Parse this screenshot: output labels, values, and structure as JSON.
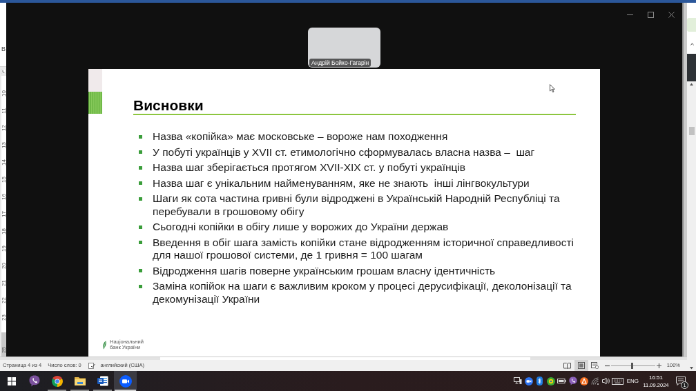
{
  "word_window": {
    "ribbon_text": "В",
    "ruler": {
      "labels": [
        "10",
        "11",
        "12",
        "13",
        "14",
        "15",
        "16",
        "17",
        "18",
        "19",
        "20",
        "21",
        "22",
        "23"
      ],
      "bottom_label": "25"
    },
    "status_bar": {
      "page": "Страница 4 из 4",
      "word_count": "Число слов: 0",
      "language": "английский (США)",
      "views": [
        {
          "kind": "read",
          "selected": false
        },
        {
          "kind": "print",
          "selected": true
        },
        {
          "kind": "web",
          "selected": false
        }
      ],
      "zoom": {
        "level": 0.48,
        "reading": "100%"
      }
    }
  },
  "zoom_window": {
    "video_tile": {
      "name": "Андрій Бойко-Гагарін"
    },
    "slide": {
      "title": "Висновки",
      "bullets": [
        "Назва «копійка» має московське – вороже нам походження",
        "У побуті українців у XVII ст. етимологічно сформувалась власна назва –  шаг",
        "Назва шаг зберігається протягом XVII-XIX ст. у побуті українців",
        "Назва шаг є унікальним найменуванням, яке не знають  інші лінгвокультури",
        "Шаги як сота частина гривні були відроджені в Українській Народній Республіці та перебували в грошовому обігу",
        "Сьогодні копійки в обігу лише у ворожих до України держав",
        "Введення в обіг шага замість копійки стане відродженням історичної справедливості для нашої грошової системи, де 1 гривня = 100 шагам",
        "Відродження шагів поверне українським грошам власну ідентичність",
        "Заміна копійок на шаги є важливим кроком у процесі дерусифікації, деколонізації та декомунізації України"
      ],
      "logo": {
        "lines": [
          "Національний",
          "банк України"
        ]
      }
    }
  },
  "taskbar": {
    "apps": [
      {
        "kind": "start",
        "open": false,
        "selected": false
      },
      {
        "kind": "chat",
        "open": false,
        "selected": false
      },
      {
        "kind": "browser",
        "open": true,
        "selected": false
      },
      {
        "kind": "folder",
        "open": true,
        "selected": false
      },
      {
        "kind": "document",
        "open": true,
        "selected": false
      },
      {
        "kind": "video",
        "open": true,
        "selected": true
      }
    ],
    "tray": {
      "language": "ENG",
      "time": "16:51",
      "date": "11.09.2024",
      "notifications": "1"
    }
  }
}
